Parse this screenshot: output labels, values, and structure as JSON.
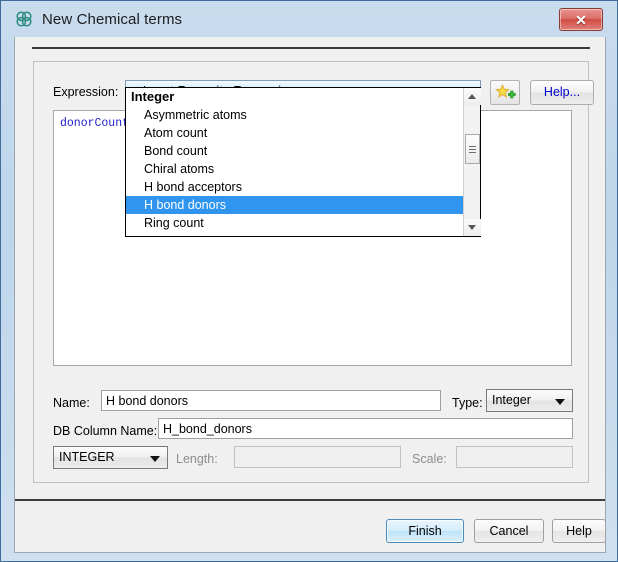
{
  "window": {
    "title": "New Chemical terms",
    "title_icon": "molecule-icon",
    "close_glyph": "✕"
  },
  "expression_section": {
    "label": "Expression:",
    "favourite_combo_value": "< Insert Favourite Expression >",
    "add_favourite_icon": "star-plus-icon",
    "help_button_label": "Help...",
    "expression_text": "donorCount"
  },
  "favourite_dropdown": {
    "open": true,
    "selected": "H bond donors",
    "items": [
      {
        "label": "Integer",
        "type": "group"
      },
      {
        "label": "Asymmetric atoms",
        "type": "item"
      },
      {
        "label": "Atom count",
        "type": "item"
      },
      {
        "label": "Bond count",
        "type": "item"
      },
      {
        "label": "Chiral atoms",
        "type": "item"
      },
      {
        "label": "H bond acceptors",
        "type": "item"
      },
      {
        "label": "H bond donors",
        "type": "item"
      },
      {
        "label": "Ring count",
        "type": "item"
      }
    ],
    "scroll_up_icon": "triangle-up-icon",
    "scroll_down_icon": "triangle-down-icon"
  },
  "form": {
    "name_label": "Name:",
    "name_value": "H bond donors",
    "name_placeholder": "",
    "type_label": "Type:",
    "type_value": "Integer",
    "db_column_label": "DB Column Name:",
    "db_column_value": "H_bond_donors",
    "db_column_placeholder": "",
    "sql_type_value": "INTEGER",
    "length_label": "Length:",
    "length_value": "",
    "length_placeholder": "",
    "scale_label": "Scale:",
    "scale_value": "",
    "scale_placeholder": ""
  },
  "footer": {
    "finish_label": "Finish",
    "cancel_label": "Cancel",
    "help_label": "Help"
  },
  "colors": {
    "accent_blue": "#2f95ef",
    "titlebar_blue": "#c9dcee",
    "close_red": "#cf4b42",
    "expression_text": "#2222cc",
    "link_blue": "#0000cc"
  }
}
